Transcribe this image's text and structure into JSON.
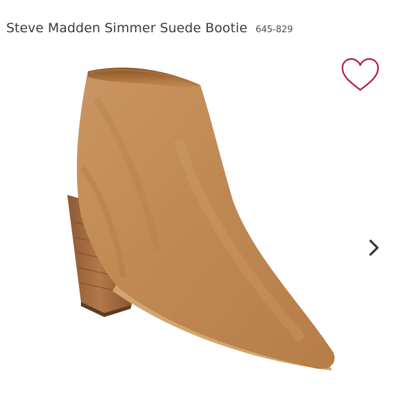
{
  "product": {
    "title": "Steve Madden Simmer Suede Bootie",
    "sku": "645-829"
  },
  "icons": {
    "favorite": "heart-outline-icon",
    "next": "chevron-right-icon"
  },
  "colors": {
    "heart": "#b0154c",
    "suede": "#c08a55",
    "heel_wood": "#a0683d",
    "arrow": "#333333"
  }
}
